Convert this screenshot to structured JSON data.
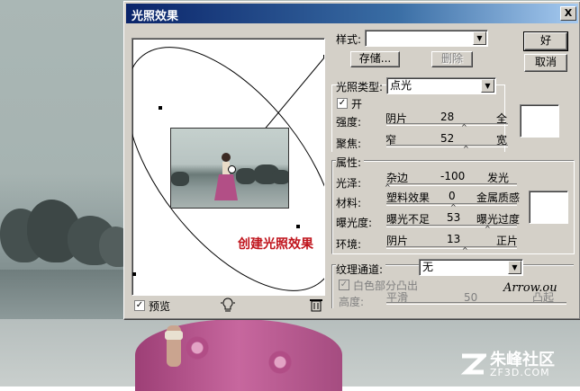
{
  "window": {
    "title": "光照效果",
    "close": "X"
  },
  "buttons": {
    "ok": "好",
    "cancel": "取消",
    "save": "存储...",
    "delete": "删除"
  },
  "style": {
    "label": "样式:",
    "value": ""
  },
  "light_type": {
    "label": "光照类型:",
    "value": "点光",
    "on_label": "开",
    "on_checked": "✓",
    "intensity": {
      "label": "强度:",
      "left": "阴片",
      "value": "28",
      "right": "全"
    },
    "focus": {
      "label": "聚焦:",
      "left": "窄",
      "value": "52",
      "right": "宽"
    }
  },
  "properties": {
    "label": "属性:",
    "gloss": {
      "label": "光泽:",
      "left": "杂边",
      "value": "-100",
      "right": "发光"
    },
    "material": {
      "label": "材料:",
      "left": "塑料效果",
      "value": "0",
      "right": "金属质感"
    },
    "exposure": {
      "label": "曝光度:",
      "left": "曝光不足",
      "value": "53",
      "right": "曝光过度"
    },
    "ambience": {
      "label": "环境:",
      "left": "阴片",
      "value": "13",
      "right": "正片"
    }
  },
  "texture": {
    "label": "纹理通道:",
    "value": "无",
    "white_high": "白色部分凸出",
    "height": {
      "label": "高度:",
      "left": "平滑",
      "value": "50",
      "right": "凸起"
    }
  },
  "preview": {
    "label": "预览",
    "checked": "✓",
    "watermark": "创建光照效果"
  },
  "signature": "Arrow.ou",
  "site_logo": {
    "text": "朱峰社区",
    "sub": "ZF3D.COM"
  },
  "icons": {
    "light": "lightbulb-icon",
    "trash": "trash-icon",
    "dropdown": "chevron-down-icon"
  }
}
